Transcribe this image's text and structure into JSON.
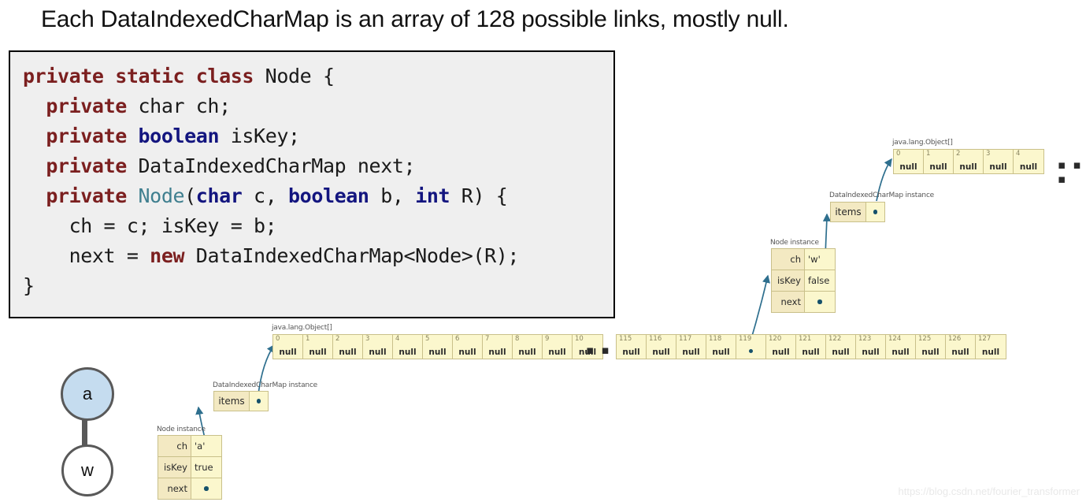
{
  "title": "Each DataIndexedCharMap is an array of 128 possible links, mostly null.",
  "code": {
    "lines": [
      "private static class Node {",
      "  private char ch;",
      "  private boolean isKey;",
      "  private DataIndexedCharMap next;",
      "  private Node(char c, boolean b, int R) {",
      "    ch = c; isKey = b;",
      "    next = new DataIndexedCharMap<Node>(R);",
      "}"
    ],
    "keyword_color": "#7b1f1f",
    "primitive_color": "#13157f",
    "type_color": "#3f7f8f",
    "background": "#efefef",
    "border_color": "#000000"
  },
  "trie": {
    "nodes": [
      {
        "label": "a",
        "fill": "#c5dcef"
      },
      {
        "label": "w",
        "fill": "#ffffff"
      }
    ],
    "edge_color": "#595959"
  },
  "diagram_colors": {
    "cell_fill": "#fbf7cd",
    "label_fill": "#f3e9c2",
    "cell_border": "#c9c08a",
    "pointer": "#16516b",
    "caption": "#555555"
  },
  "ellipsis_glyph": "▪ ▪ ▪",
  "lower": {
    "node_instance": {
      "caption": "Node instance",
      "rows": [
        {
          "field": "ch",
          "value": "'a'"
        },
        {
          "field": "isKey",
          "value": "true"
        },
        {
          "field": "next",
          "value": ""
        }
      ]
    },
    "dicm": {
      "caption": "DataIndexedCharMap instance",
      "items_label": "items"
    },
    "array": {
      "caption": "java.lang.Object[]",
      "head_cells": [
        {
          "index": "0",
          "value": "null"
        },
        {
          "index": "1",
          "value": "null"
        },
        {
          "index": "2",
          "value": "null"
        },
        {
          "index": "3",
          "value": "null"
        },
        {
          "index": "4",
          "value": "null"
        },
        {
          "index": "5",
          "value": "null"
        },
        {
          "index": "6",
          "value": "null"
        },
        {
          "index": "7",
          "value": "null"
        },
        {
          "index": "8",
          "value": "null"
        },
        {
          "index": "9",
          "value": "null"
        },
        {
          "index": "10",
          "value": "null"
        }
      ],
      "tail_cells": [
        {
          "index": "115",
          "value": "null"
        },
        {
          "index": "116",
          "value": "null"
        },
        {
          "index": "117",
          "value": "null"
        },
        {
          "index": "118",
          "value": "null"
        },
        {
          "index": "119",
          "value": ""
        },
        {
          "index": "120",
          "value": "null"
        },
        {
          "index": "121",
          "value": "null"
        },
        {
          "index": "122",
          "value": "null"
        },
        {
          "index": "123",
          "value": "null"
        },
        {
          "index": "124",
          "value": "null"
        },
        {
          "index": "125",
          "value": "null"
        },
        {
          "index": "126",
          "value": "null"
        },
        {
          "index": "127",
          "value": "null"
        }
      ]
    }
  },
  "upper": {
    "node_instance": {
      "caption": "Node instance",
      "rows": [
        {
          "field": "ch",
          "value": "'w'"
        },
        {
          "field": "isKey",
          "value": "false"
        },
        {
          "field": "next",
          "value": ""
        }
      ]
    },
    "dicm": {
      "caption": "DataIndexedCharMap instance",
      "items_label": "items"
    },
    "array": {
      "caption": "java.lang.Object[]",
      "head_cells": [
        {
          "index": "0",
          "value": "null"
        },
        {
          "index": "1",
          "value": "null"
        },
        {
          "index": "2",
          "value": "null"
        },
        {
          "index": "3",
          "value": "null"
        },
        {
          "index": "4",
          "value": "null"
        }
      ]
    }
  },
  "watermark": "https://blog.csdn.net/fourier_transformer"
}
